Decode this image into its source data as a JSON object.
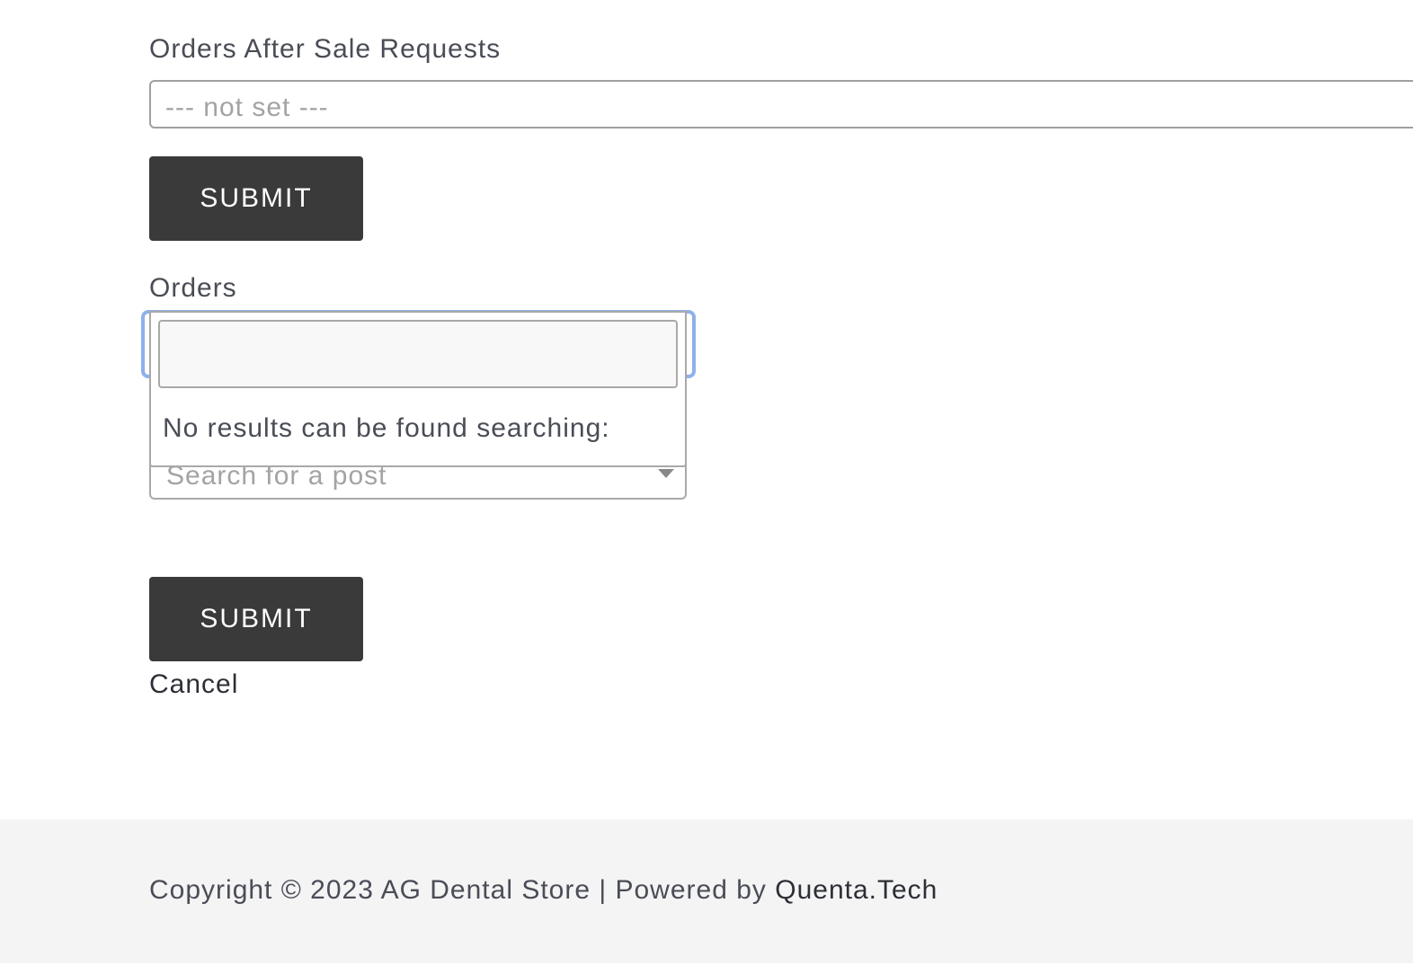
{
  "form": {
    "after_sale_label": "Orders After Sale Requests",
    "after_sale_placeholder": "--- not set ---",
    "submit_label_1": "SUBMIT",
    "orders_label": "Orders",
    "orders_search_value": "",
    "no_results_message": "No results can be found searching:",
    "post_select_placeholder": "Search for a post",
    "submit_label_2": "SUBMIT",
    "cancel_label": "Cancel"
  },
  "footer": {
    "copyright_text": "Copyright © 2023 AG Dental Store | Powered by ",
    "powered_by_link": "Quenta.Tech"
  },
  "colors": {
    "button_bg": "#3a3a3a",
    "focus_ring": "#8fb0ea",
    "footer_bg": "#f4f4f5"
  },
  "icons": {
    "post_select_arrow": "caret-down-icon"
  }
}
